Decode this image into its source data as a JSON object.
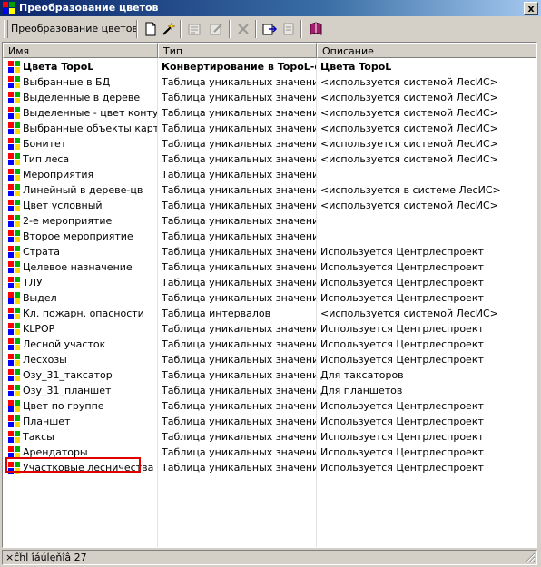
{
  "window": {
    "title": "Преобразование цветов",
    "close_label": "x"
  },
  "toolbar": {
    "label": "Преобразование цветов",
    "buttons": [
      {
        "icon": "new-document-icon",
        "enabled": true
      },
      {
        "icon": "magic-wand-icon",
        "enabled": true
      },
      {
        "icon": "properties-icon",
        "enabled": false
      },
      {
        "icon": "edit-icon",
        "enabled": false
      },
      {
        "icon": "delete-icon",
        "enabled": false
      },
      {
        "icon": "import-icon",
        "enabled": true
      },
      {
        "icon": "export-icon",
        "enabled": false
      },
      {
        "icon": "book-icon",
        "enabled": true
      }
    ]
  },
  "table": {
    "columns": [
      "Имя",
      "Тип",
      "Описание"
    ],
    "rows": [
      {
        "name": "Цвета TopoL",
        "type": "Конвертирование в TopoL-e",
        "desc": "Цвета TopoL",
        "bold": true
      },
      {
        "name": "Выбранные в БД",
        "type": "Таблица уникальных значений",
        "desc": "<используется системой ЛесИС>"
      },
      {
        "name": "Выделенные в дереве",
        "type": "Таблица уникальных значений",
        "desc": "<используется системой ЛесИС>"
      },
      {
        "name": "Выделенные - цвет контура",
        "type": "Таблица уникальных значений",
        "desc": "<используется системой ЛесИС>"
      },
      {
        "name": "Выбранные объекты карты",
        "type": "Таблица уникальных значений",
        "desc": "<используется системой ЛесИС>"
      },
      {
        "name": "Бонитет",
        "type": "Таблица уникальных значений",
        "desc": "<используется системой ЛесИС>"
      },
      {
        "name": "Тип леса",
        "type": "Таблица уникальных значений",
        "desc": "<используется системой ЛесИС>"
      },
      {
        "name": "Мероприятия",
        "type": "Таблица уникальных значений",
        "desc": ""
      },
      {
        "name": "Линейный в дереве-цв",
        "type": "Таблица уникальных значений",
        "desc": "<используется в системе ЛесИС>"
      },
      {
        "name": "Цвет условный",
        "type": "Таблица уникальных значений",
        "desc": "<используется системой ЛесИС>"
      },
      {
        "name": "2-е мероприятие",
        "type": "Таблица уникальных значений",
        "desc": ""
      },
      {
        "name": "Второе мероприятие",
        "type": "Таблица уникальных значений",
        "desc": ""
      },
      {
        "name": "Страта",
        "type": "Таблица уникальных значений",
        "desc": "Используется Центрлеспроект"
      },
      {
        "name": "Целевое назначение",
        "type": "Таблица уникальных значений",
        "desc": "Используется Центрлеспроект"
      },
      {
        "name": "ТЛУ",
        "type": "Таблица уникальных значений",
        "desc": "Используется Центрлеспроект"
      },
      {
        "name": "Выдел",
        "type": "Таблица уникальных значений",
        "desc": "Используется Центрлеспроект"
      },
      {
        "name": "Кл. пожарн. опасности",
        "type": "Таблица интервалов",
        "desc": "<используется системой ЛесИС>"
      },
      {
        "name": "KLPOP",
        "type": "Таблица уникальных значений",
        "desc": "Используется Центрлеспроект"
      },
      {
        "name": "Лесной участок",
        "type": "Таблица уникальных значений",
        "desc": "Используется Центрлеспроект"
      },
      {
        "name": "Лесхозы",
        "type": "Таблица уникальных значений",
        "desc": "Используется Центрлеспроект"
      },
      {
        "name": "Озу_31_таксатор",
        "type": "Таблица уникальных значений",
        "desc": "Для таксаторов"
      },
      {
        "name": "Озу_31_планшет",
        "type": "Таблица уникальных значений",
        "desc": "Для планшетов"
      },
      {
        "name": "Цвет по группе",
        "type": "Таблица уникальных значений",
        "desc": "Используется Центрлеспроект"
      },
      {
        "name": "Планшет",
        "type": "Таблица уникальных значений",
        "desc": "Используется Центрлеспроект"
      },
      {
        "name": "Таксы",
        "type": "Таблица уникальных значений",
        "desc": "Используется Центрлеспроект"
      },
      {
        "name": "Арендаторы",
        "type": "Таблица уникальных значений",
        "desc": "Используется Центрлеспроект"
      },
      {
        "name": "Участковые лесничества",
        "type": "Таблица уникальных значений",
        "desc": "Используется Центрлеспроект"
      }
    ]
  },
  "status": {
    "text": "×ĉĥĺ îáúĺęňîâ 27"
  },
  "colors": {
    "highlight": "#e00000",
    "title_start": "#0a246a"
  }
}
